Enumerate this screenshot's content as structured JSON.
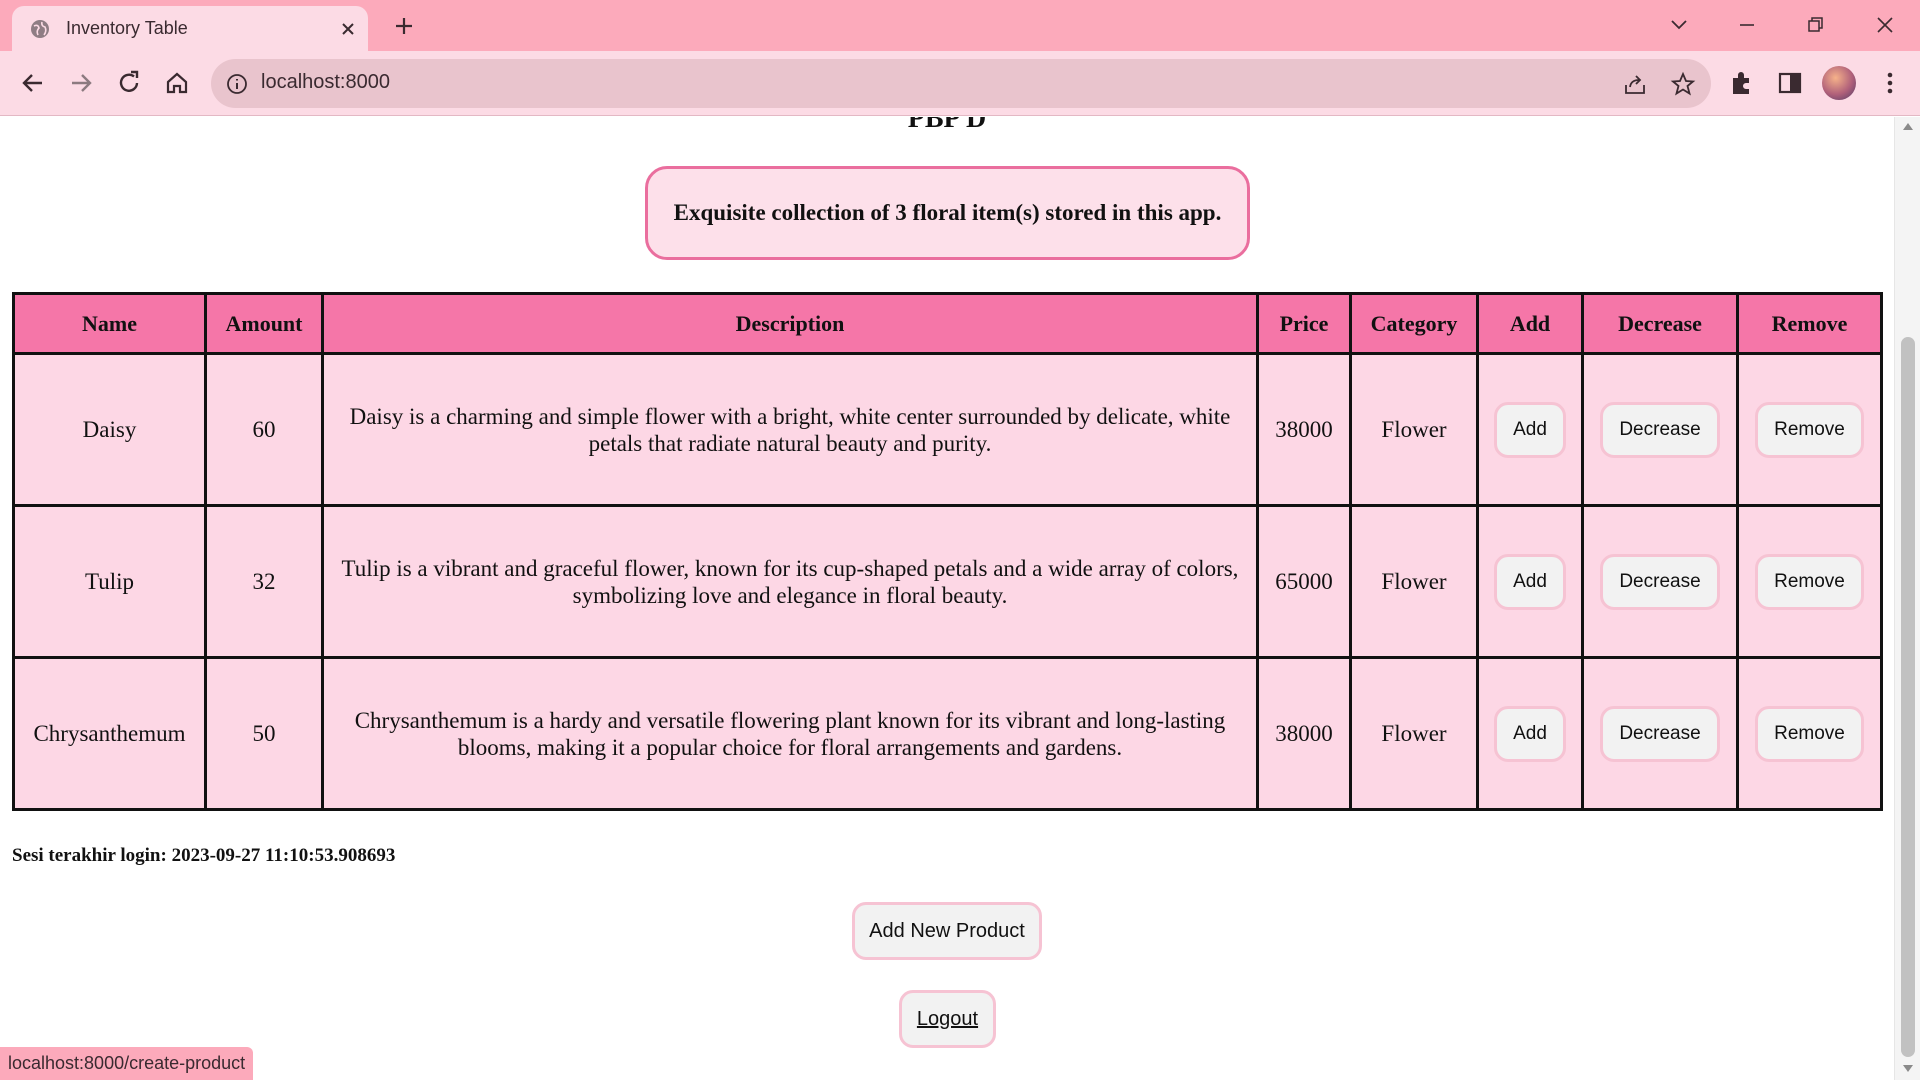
{
  "browser": {
    "tab_title": "Inventory Table",
    "url": "localhost:8000",
    "status_url": "localhost:8000/create-product"
  },
  "page": {
    "title": "PBP D",
    "banner": "Exquisite collection of 3 floral item(s) stored in this app.",
    "table": {
      "headers": [
        "Name",
        "Amount",
        "Description",
        "Price",
        "Category",
        "Add",
        "Decrease",
        "Remove"
      ],
      "rows": [
        {
          "name": "Daisy",
          "amount": "60",
          "description": "Daisy is a charming and simple flower with a bright, white center surrounded by delicate, white petals that radiate natural beauty and purity.",
          "price": "38000",
          "category": "Flower",
          "add": "Add",
          "decrease": "Decrease",
          "remove": "Remove"
        },
        {
          "name": "Tulip",
          "amount": "32",
          "description": "Tulip is a vibrant and graceful flower, known for its cup-shaped petals and a wide array of colors, symbolizing love and elegance in floral beauty.",
          "price": "65000",
          "category": "Flower",
          "add": "Add",
          "decrease": "Decrease",
          "remove": "Remove"
        },
        {
          "name": "Chrysanthemum",
          "amount": "50",
          "description": "Chrysanthemum is a hardy and versatile flowering plant known for its vibrant and long-lasting blooms, making it a popular choice for floral arrangements and gardens.",
          "price": "38000",
          "category": "Flower",
          "add": "Add",
          "decrease": "Decrease",
          "remove": "Remove"
        }
      ]
    },
    "last_login": "Sesi terakhir login: 2023-09-27 11:10:53.908693",
    "add_product_label": "Add New Product",
    "logout_label": "Logout"
  },
  "theme": {
    "chrome_pink": "#fcaabb",
    "header_pink": "#f576a8",
    "cell_pink": "#fdd7e5",
    "banner_border": "#ea6e9e"
  },
  "icons": [
    "globe-icon",
    "close-icon",
    "plus-icon",
    "chevron-down-icon",
    "minimize-icon",
    "restore-icon",
    "window-close-icon",
    "back-icon",
    "forward-icon",
    "reload-icon",
    "home-icon",
    "info-icon",
    "share-icon",
    "star-icon",
    "extensions-icon",
    "side-panel-icon",
    "menu-icon"
  ]
}
